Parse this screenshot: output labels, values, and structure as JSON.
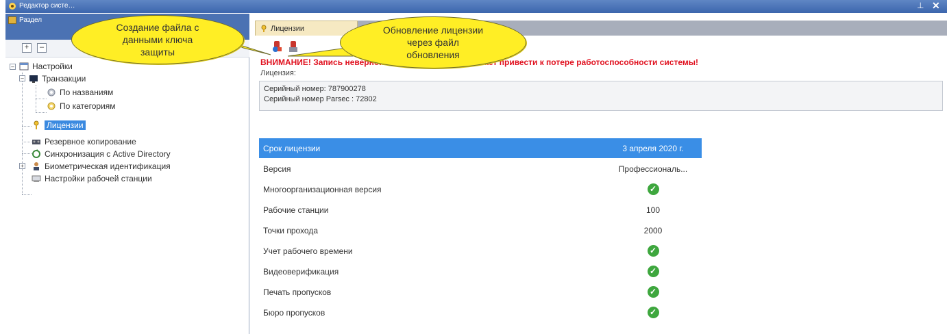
{
  "window": {
    "title": "Редактор систе…"
  },
  "left_panel": {
    "title": "Раздел",
    "toolbar": {
      "expand_label": "+",
      "collapse_label": "–"
    },
    "tree": [
      {
        "label": "Настройки"
      },
      {
        "label": "Транзакции"
      },
      {
        "label": "По названиям"
      },
      {
        "label": "По категориям"
      },
      {
        "label": "Лицензии"
      },
      {
        "label": "Резервное копирование"
      },
      {
        "label": "Синхронизация с Active Directory"
      },
      {
        "label": "Биометрическая идентификация"
      },
      {
        "label": "Настройки рабочей станции"
      }
    ]
  },
  "tab": {
    "label": "Лицензии"
  },
  "warning_text": "ВНИМАНИЕ! Запись неверной информации в ключ может привести к потере работоспособности системы!",
  "license_label": "Лицензия:",
  "serial": "Серийный номер: 787900278",
  "serial_parsec": "Серийный номер Parsec : 72802",
  "rows": [
    {
      "name": "Срок лицензии",
      "value": "3 апреля 2020 г."
    },
    {
      "name": "Версия",
      "value": "Профессиональ..."
    },
    {
      "name": "Многоорганизационная версия",
      "check": true
    },
    {
      "name": "Рабочие станции",
      "value": "100"
    },
    {
      "name": "Точки прохода",
      "value": "2000"
    },
    {
      "name": "Учет рабочего времени",
      "check": true
    },
    {
      "name": "Видеоверификация",
      "check": true
    },
    {
      "name": "Печать пропусков",
      "check": true
    },
    {
      "name": "Бюро пропусков",
      "check": true
    }
  ],
  "callouts": {
    "create": "Создание файла с данными ключа защиты",
    "update": "Обновление лицензии через файл обновления"
  },
  "colors": {
    "warning": "#e0101e",
    "selection": "#3a8ee6",
    "callout": "#ffee25",
    "header": "#4b72b3"
  }
}
